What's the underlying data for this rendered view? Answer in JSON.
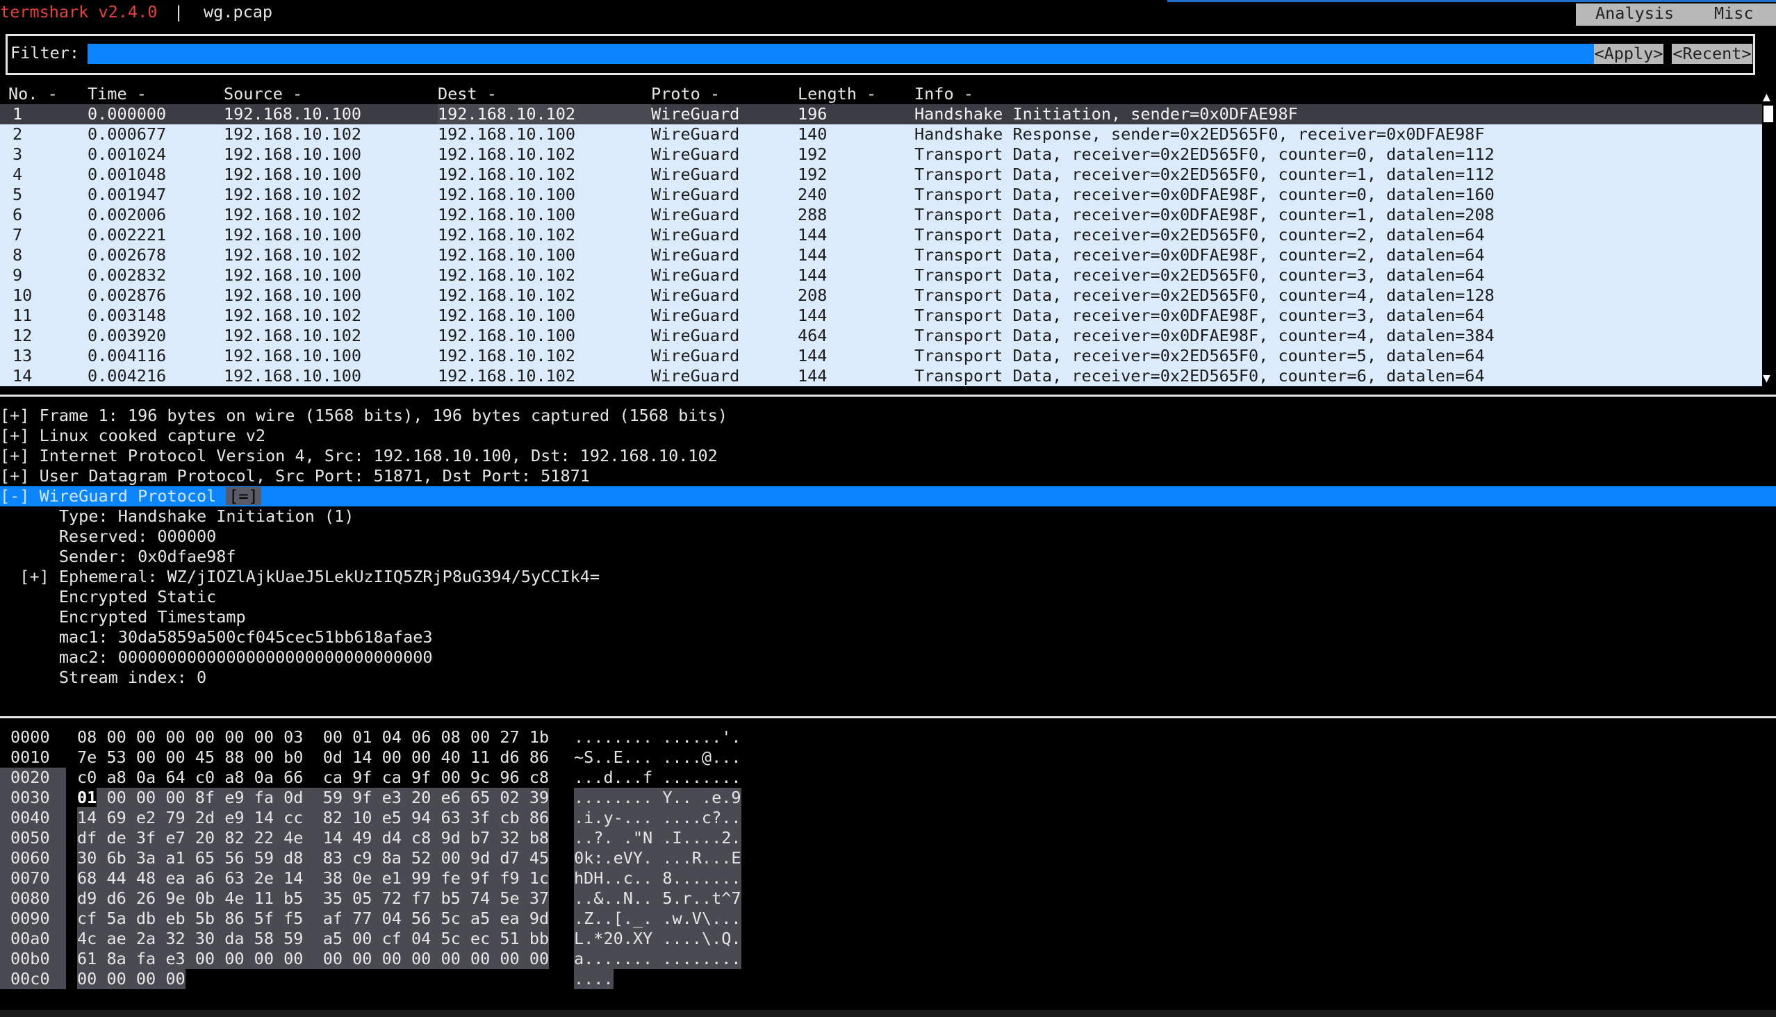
{
  "titlebar": {
    "app_title": "termshark v2.4.0",
    "separator": "|",
    "file_name": "wg.pcap",
    "menu": [
      "Analysis",
      "Misc"
    ]
  },
  "filter": {
    "label": "Filter:",
    "value": "",
    "apply_label": "<Apply>",
    "recent_label": "<Recent>"
  },
  "packet_list": {
    "columns": [
      "No. -",
      "Time -",
      "Source -",
      "Dest -",
      "Proto -",
      "Length -",
      "Info -"
    ],
    "selected_index": 0,
    "rows": [
      [
        "1",
        "0.000000",
        "192.168.10.100",
        "192.168.10.102",
        "WireGuard",
        "196",
        "Handshake Initiation, sender=0x0DFAE98F"
      ],
      [
        "2",
        "0.000677",
        "192.168.10.102",
        "192.168.10.100",
        "WireGuard",
        "140",
        "Handshake Response, sender=0x2ED565F0, receiver=0x0DFAE98F"
      ],
      [
        "3",
        "0.001024",
        "192.168.10.100",
        "192.168.10.102",
        "WireGuard",
        "192",
        "Transport Data, receiver=0x2ED565F0, counter=0, datalen=112"
      ],
      [
        "4",
        "0.001048",
        "192.168.10.100",
        "192.168.10.102",
        "WireGuard",
        "192",
        "Transport Data, receiver=0x2ED565F0, counter=1, datalen=112"
      ],
      [
        "5",
        "0.001947",
        "192.168.10.102",
        "192.168.10.100",
        "WireGuard",
        "240",
        "Transport Data, receiver=0x0DFAE98F, counter=0, datalen=160"
      ],
      [
        "6",
        "0.002006",
        "192.168.10.102",
        "192.168.10.100",
        "WireGuard",
        "288",
        "Transport Data, receiver=0x0DFAE98F, counter=1, datalen=208"
      ],
      [
        "7",
        "0.002221",
        "192.168.10.100",
        "192.168.10.102",
        "WireGuard",
        "144",
        "Transport Data, receiver=0x2ED565F0, counter=2, datalen=64"
      ],
      [
        "8",
        "0.002678",
        "192.168.10.102",
        "192.168.10.100",
        "WireGuard",
        "144",
        "Transport Data, receiver=0x0DFAE98F, counter=2, datalen=64"
      ],
      [
        "9",
        "0.002832",
        "192.168.10.100",
        "192.168.10.102",
        "WireGuard",
        "144",
        "Transport Data, receiver=0x2ED565F0, counter=3, datalen=64"
      ],
      [
        "10",
        "0.002876",
        "192.168.10.100",
        "192.168.10.102",
        "WireGuard",
        "208",
        "Transport Data, receiver=0x2ED565F0, counter=4, datalen=128"
      ],
      [
        "11",
        "0.003148",
        "192.168.10.102",
        "192.168.10.100",
        "WireGuard",
        "144",
        "Transport Data, receiver=0x0DFAE98F, counter=3, datalen=64"
      ],
      [
        "12",
        "0.003920",
        "192.168.10.102",
        "192.168.10.100",
        "WireGuard",
        "464",
        "Transport Data, receiver=0x0DFAE98F, counter=4, datalen=384"
      ],
      [
        "13",
        "0.004116",
        "192.168.10.100",
        "192.168.10.102",
        "WireGuard",
        "144",
        "Transport Data, receiver=0x2ED565F0, counter=5, datalen=64"
      ],
      [
        "14",
        "0.004216",
        "192.168.10.100",
        "192.168.10.102",
        "WireGuard",
        "144",
        "Transport Data, receiver=0x2ED565F0, counter=6, datalen=64"
      ]
    ],
    "scroll_up_icon": "▲",
    "scroll_down_icon": "▼"
  },
  "details": {
    "selected_index": 4,
    "lines": [
      {
        "indent": "",
        "text": "[+] Frame 1: 196 bytes on wire (1568 bits), 196 bytes captured (1568 bits)",
        "badge": ""
      },
      {
        "indent": "",
        "text": "[+] Linux cooked capture v2",
        "badge": ""
      },
      {
        "indent": "",
        "text": "[+] Internet Protocol Version 4, Src: 192.168.10.100, Dst: 192.168.10.102",
        "badge": ""
      },
      {
        "indent": "",
        "text": "[+] User Datagram Protocol, Src Port: 51871, Dst Port: 51871",
        "badge": ""
      },
      {
        "indent": "",
        "text": "[-] WireGuard Protocol",
        "badge": "[=]"
      },
      {
        "indent": "      ",
        "text": "Type: Handshake Initiation (1)",
        "badge": ""
      },
      {
        "indent": "      ",
        "text": "Reserved: 000000",
        "badge": ""
      },
      {
        "indent": "      ",
        "text": "Sender: 0x0dfae98f",
        "badge": ""
      },
      {
        "indent": "  ",
        "text": "[+] Ephemeral: WZ/jIOZlAjkUaeJ5LekUzIIQ5ZRjP8uG394/5yCCIk4=",
        "badge": ""
      },
      {
        "indent": "      ",
        "text": "Encrypted Static",
        "badge": ""
      },
      {
        "indent": "      ",
        "text": "Encrypted Timestamp",
        "badge": ""
      },
      {
        "indent": "      ",
        "text": "mac1: 30da5859a500cf045cec51bb618afae3",
        "badge": ""
      },
      {
        "indent": "      ",
        "text": "mac2: 00000000000000000000000000000000",
        "badge": ""
      },
      {
        "indent": "      ",
        "text": "Stream index: 0",
        "badge": ""
      }
    ]
  },
  "hexdump": {
    "highlight_from_row": 2,
    "rows": [
      {
        "offset": "0000",
        "bytes": "08 00 00 00 00 00 00 03  00 01 04 06 08 00 27 1b",
        "ascii": "........ ......'."
      },
      {
        "offset": "0010",
        "bytes": "7e 53 00 00 45 88 00 b0  0d 14 00 00 40 11 d6 86",
        "ascii": "~S..E... ....@..."
      },
      {
        "offset": "0020",
        "bytes": "c0 a8 0a 64 c0 a8 0a 66  ca 9f ca 9f 00 9c 96 c8",
        "ascii": "...d...f ........"
      },
      {
        "offset": "0030",
        "bytes": "01 00 00 00 8f e9 fa 0d  59 9f e3 20 e6 65 02 39",
        "ascii": "........ Y.. .e.9"
      },
      {
        "offset": "0040",
        "bytes": "14 69 e2 79 2d e9 14 cc  82 10 e5 94 63 3f cb 86",
        "ascii": ".i.y-... ....c?.."
      },
      {
        "offset": "0050",
        "bytes": "df de 3f e7 20 82 22 4e  14 49 d4 c8 9d b7 32 b8",
        "ascii": "..?. .\"N .I....2."
      },
      {
        "offset": "0060",
        "bytes": "30 6b 3a a1 65 56 59 d8  83 c9 8a 52 00 9d d7 45",
        "ascii": "0k:.eVY. ...R...E"
      },
      {
        "offset": "0070",
        "bytes": "68 44 48 ea a6 63 2e 14  38 0e e1 99 fe 9f f9 1c",
        "ascii": "hDH..c.. 8......."
      },
      {
        "offset": "0080",
        "bytes": "d9 d6 26 9e 0b 4e 11 b5  35 05 72 f7 b5 74 5e 37",
        "ascii": "..&..N.. 5.r..t^7"
      },
      {
        "offset": "0090",
        "bytes": "cf 5a db eb 5b 86 5f f5  af 77 04 56 5c a5 ea 9d",
        "ascii": ".Z..[._. .w.V\\..."
      },
      {
        "offset": "00a0",
        "bytes": "4c ae 2a 32 30 da 58 59  a5 00 cf 04 5c ec 51 bb",
        "ascii": "L.*20.XY ....\\.Q."
      },
      {
        "offset": "00b0",
        "bytes": "61 8a fa e3 00 00 00 00  00 00 00 00 00 00 00 00",
        "ascii": "a....... ........"
      },
      {
        "offset": "00c0",
        "bytes": "00 00 00 00",
        "ascii": "...."
      }
    ]
  }
}
